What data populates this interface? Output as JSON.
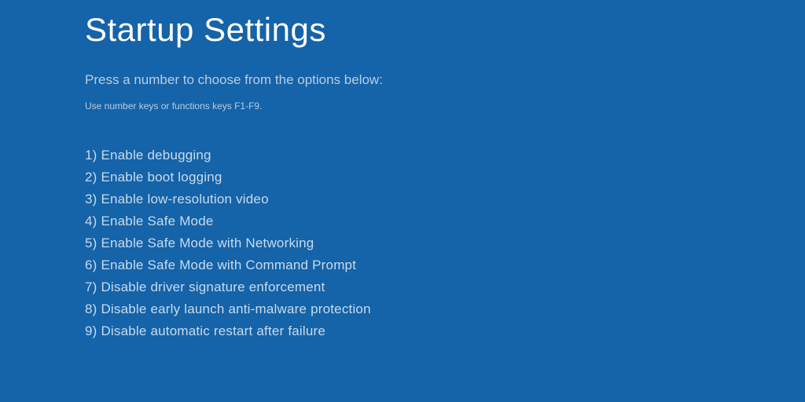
{
  "title": "Startup Settings",
  "instruction": "Press a number to choose from the options below:",
  "hint": "Use number keys or functions keys F1-F9.",
  "options": [
    "1) Enable debugging",
    "2) Enable boot logging",
    "3) Enable low-resolution video",
    "4) Enable Safe Mode",
    "5) Enable Safe Mode with Networking",
    "6) Enable Safe Mode with Command Prompt",
    "7) Disable driver signature enforcement",
    "8) Disable early launch anti-malware protection",
    "9) Disable automatic restart after failure"
  ]
}
